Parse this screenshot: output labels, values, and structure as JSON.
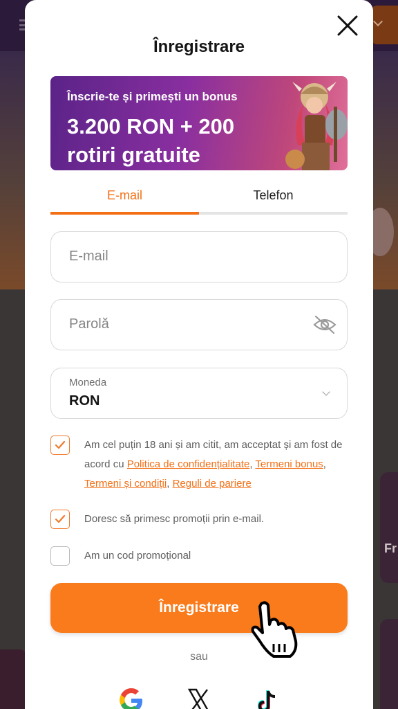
{
  "background": {
    "partial_text": "Fr"
  },
  "modal": {
    "title": "Înregistrare",
    "close_icon": "close-icon",
    "promo": {
      "subtitle": "Înscrie-te și primești un bonus",
      "headline": "3.200 RON + 200 rotiri gratuite",
      "image_icon": "viking-character-illustration"
    },
    "tabs": [
      {
        "label": "E-mail",
        "active": true
      },
      {
        "label": "Telefon",
        "active": false
      }
    ],
    "email_field": {
      "placeholder": "E-mail",
      "value": ""
    },
    "password_field": {
      "placeholder": "Parolă",
      "value": "",
      "icon": "eye-off-icon"
    },
    "currency_field": {
      "label": "Moneda",
      "value": "RON",
      "icon": "chevron-down-icon"
    },
    "checkboxes": {
      "terms": {
        "checked": true,
        "text_before": "Am cel puțin 18 ani și am citit, am acceptat și am fost de acord cu ",
        "link_privacy": "Politica de confidențialitate",
        "sep1": ", ",
        "link_bonus": "Termeni bonus",
        "sep2": ", ",
        "link_terms": "Termeni și condiții",
        "sep3": ", ",
        "link_betting": "Reguli de pariere"
      },
      "promotions": {
        "checked": true,
        "text": "Doresc să primesc promoții prin e-mail."
      },
      "promo_code": {
        "checked": false,
        "text": "Am un cod promoțional"
      }
    },
    "submit_label": "Înregistrare",
    "separator": "sau",
    "social": [
      "google-icon",
      "x-icon",
      "tiktok-icon"
    ],
    "colors": {
      "accent": "#f97b1b",
      "tab_active": "#f26f15",
      "promo_gradient_start": "#5a2388"
    }
  }
}
